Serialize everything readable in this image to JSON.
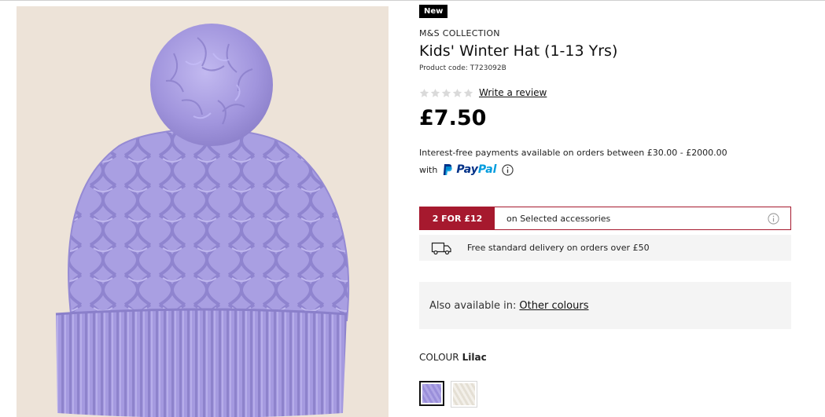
{
  "product": {
    "badge": "New",
    "brand": "M&S COLLECTION",
    "title": "Kids' Winter Hat (1-13 Yrs)",
    "code_label": "Product code:",
    "code": "T723092B",
    "rating": 0,
    "rating_max": 5,
    "write_review": "Write a review",
    "price": "£7.50"
  },
  "finance": {
    "line1": "Interest-free payments available on orders between £30.00 - £2000.00",
    "with": "with",
    "paypal_pay": "Pay",
    "paypal_pal": "Pal"
  },
  "offer": {
    "tag": "2 FOR £12",
    "text": "on Selected accessories"
  },
  "delivery": {
    "text": "Free standard delivery on orders over £50"
  },
  "availability": {
    "label": "Also available in:",
    "link": "Other colours"
  },
  "colour": {
    "label": "COLOUR",
    "selected": "Lilac",
    "swatches": [
      {
        "name": "Lilac",
        "color": "#a79ce0",
        "selected": true
      },
      {
        "name": "Cream",
        "color": "#eeebe3",
        "selected": false
      }
    ]
  },
  "colors": {
    "accent": "#a6192e",
    "hat": "#a79ce0",
    "image_background": "#ede3d8",
    "panel": "#f4f4f4"
  },
  "icons": [
    "paypal-logo-icon",
    "info-icon",
    "delivery-van-icon",
    "star-icon"
  ]
}
